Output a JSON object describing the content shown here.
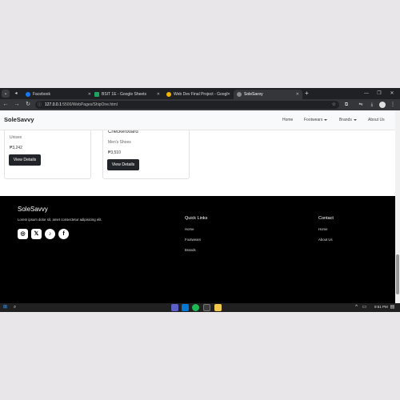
{
  "browser": {
    "tabs": [
      {
        "title": "Facebook",
        "favicon_color": "#1877f2"
      },
      {
        "title": "BSIT 1E - Google Sheets",
        "favicon_color": "#1fa463"
      },
      {
        "title": "Web Dev Final Project - Googl",
        "favicon_color": "#f4b400"
      },
      {
        "title": "SoleSavvy",
        "favicon_color": "#8a8a8a"
      }
    ],
    "address": {
      "host": "127.0.0.1",
      "path": ":5500/WebPages/ShipOne.html"
    }
  },
  "navbar": {
    "brand": "SoleSavvy",
    "links": [
      "Home",
      "Footwears",
      "Brands",
      "About Us"
    ]
  },
  "cards": [
    {
      "title": "",
      "category": "Unisex",
      "price": "₱3,242",
      "button": "View Details"
    },
    {
      "title": "Checkerboard",
      "category": "Men's Shoes",
      "price": "₱3,510",
      "button": "View Details"
    }
  ],
  "footer": {
    "brand": "SoleSavvy",
    "description": "Lorem ipsum dolor sit, amet consectetur adipisicing elit.",
    "quick_links": {
      "heading": "Quick Links",
      "items": [
        "Home",
        "Footwears",
        "Brands"
      ]
    },
    "contact": {
      "heading": "Contact",
      "items": [
        "Home",
        "About Us"
      ]
    },
    "social_icons": [
      "instagram-icon",
      "x-icon",
      "tiktok-icon",
      "facebook-icon"
    ]
  },
  "taskbar": {
    "time": "9:51 PM"
  }
}
